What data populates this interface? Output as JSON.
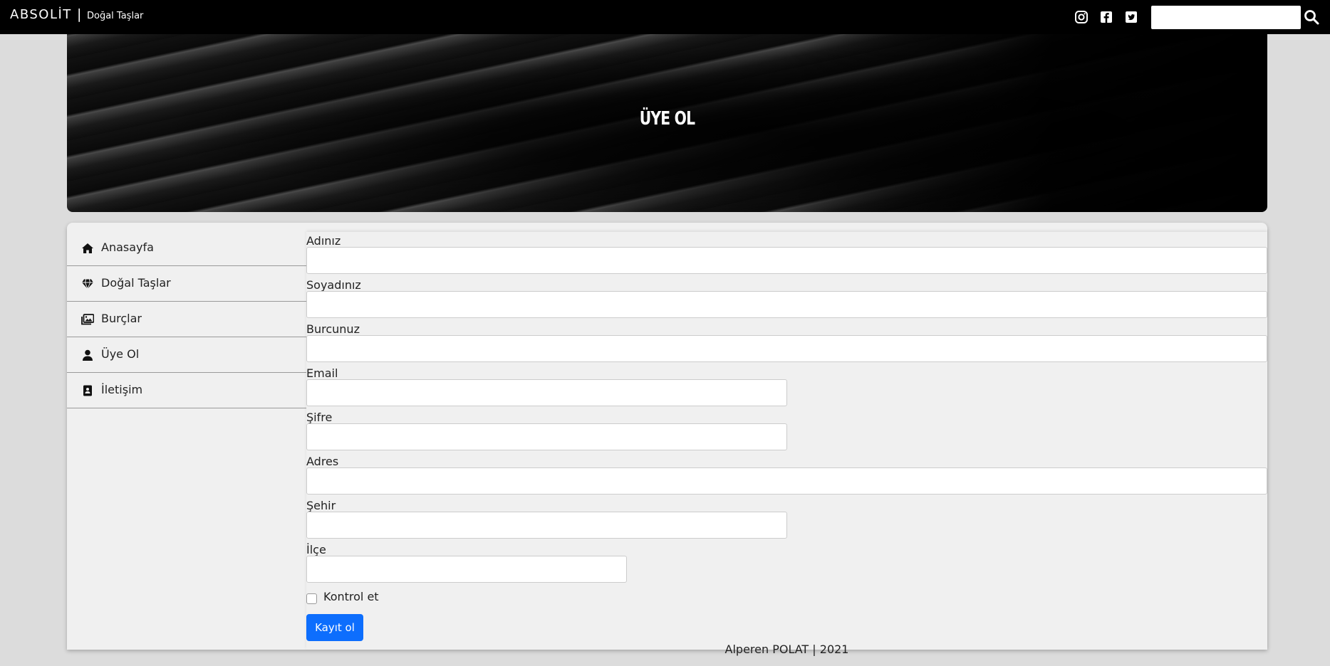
{
  "topbar": {
    "brand": "ABSOLİT",
    "separator": "|",
    "subtitle": "Doğal Taşlar",
    "social_icons": [
      "instagram-icon",
      "facebook-icon",
      "twitter-icon"
    ],
    "search": {
      "placeholder": "",
      "value": ""
    }
  },
  "hero": {
    "title": "ÜYE OL"
  },
  "sidebar": {
    "items": [
      {
        "label": "Anasayfa",
        "icon": "home-icon"
      },
      {
        "label": "Doğal Taşlar",
        "icon": "gem-icon"
      },
      {
        "label": "Burçlar",
        "icon": "images-icon"
      },
      {
        "label": "Üye Ol",
        "icon": "user-icon"
      },
      {
        "label": "İletişim",
        "icon": "contact-book-icon"
      }
    ]
  },
  "form": {
    "fields": [
      {
        "label": "Adınız",
        "value": ""
      },
      {
        "label": "Soyadınız",
        "value": ""
      },
      {
        "label": "Burcunuz",
        "value": ""
      },
      {
        "label": "Email",
        "value": ""
      },
      {
        "label": "Şifre",
        "value": ""
      },
      {
        "label": "Adres",
        "value": ""
      },
      {
        "label": "Şehir",
        "value": ""
      },
      {
        "label": "İlçe",
        "value": ""
      }
    ],
    "checkbox": {
      "label": "Kontrol et",
      "checked": false
    },
    "submit_label": "Kayıt ol"
  },
  "footer": {
    "text": "Alperen POLAT | 2021"
  },
  "colors": {
    "topbar_bg": "#000000",
    "page_bg": "#dcdcdc",
    "panel_bg": "#f0f0f0",
    "button_bg": "#0d6efd"
  }
}
